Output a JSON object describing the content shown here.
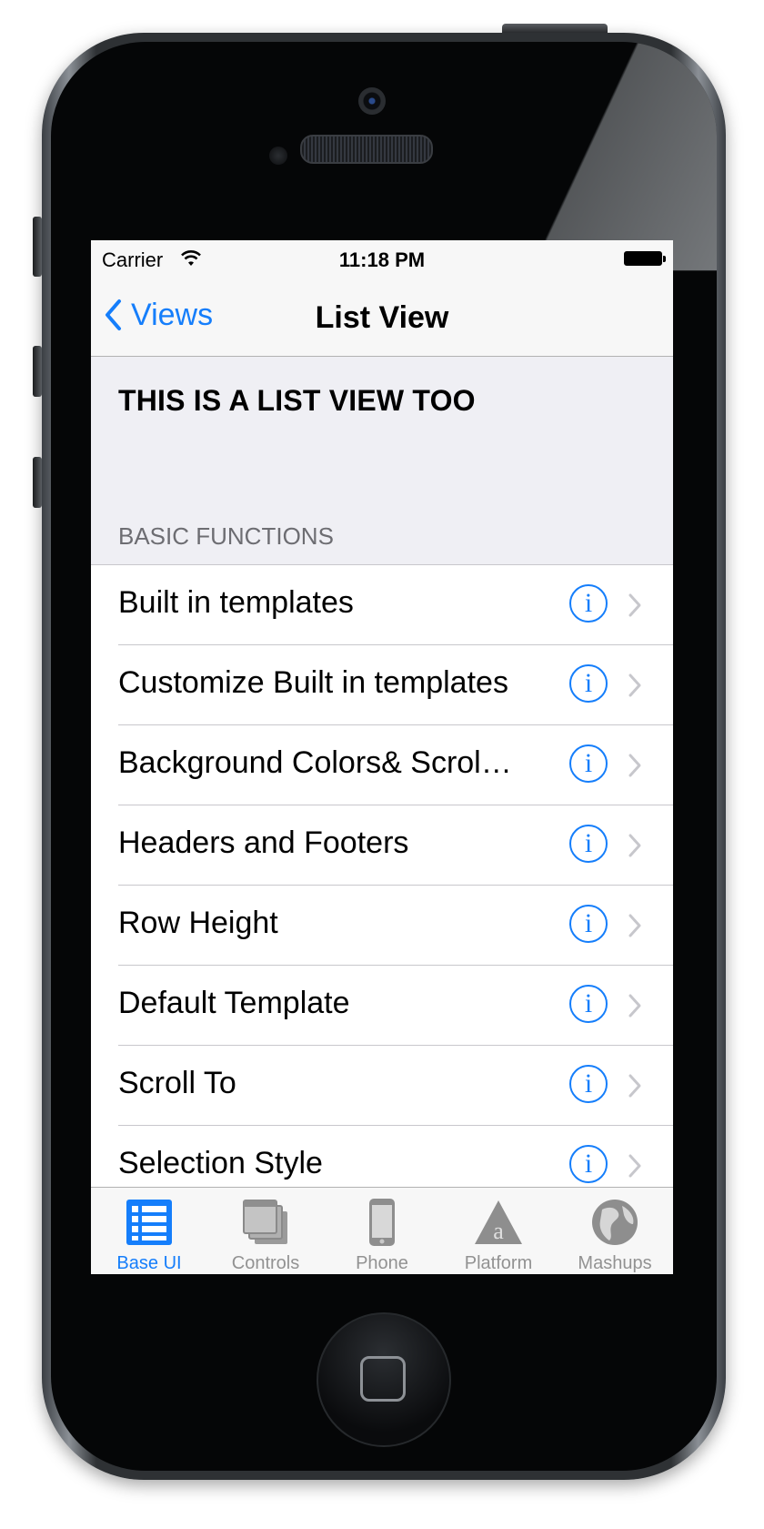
{
  "status_bar": {
    "carrier": "Carrier",
    "time": "11:18 PM"
  },
  "nav": {
    "back_label": "Views",
    "title": "List View"
  },
  "list": {
    "header_title": "THIS IS A LIST VIEW TOO",
    "section_header": "BASIC FUNCTIONS",
    "rows": [
      {
        "label": "Built in templates",
        "info": "i"
      },
      {
        "label": "Customize Built in templates",
        "info": "i"
      },
      {
        "label": "Background Colors& Scroll…",
        "info": "i"
      },
      {
        "label": "Headers and Footers",
        "info": "i"
      },
      {
        "label": "Row Height",
        "info": "i"
      },
      {
        "label": "Default Template",
        "info": "i"
      },
      {
        "label": "Scroll To",
        "info": "i"
      },
      {
        "label": "Selection Style",
        "info": "i"
      }
    ]
  },
  "tabs": [
    {
      "label": "Base UI",
      "icon": "list-grid-icon",
      "active": true
    },
    {
      "label": "Controls",
      "icon": "stacked-windows-icon",
      "active": false
    },
    {
      "label": "Phone",
      "icon": "phone-icon",
      "active": false
    },
    {
      "label": "Platform",
      "icon": "platform-a-icon",
      "active": false
    },
    {
      "label": "Mashups",
      "icon": "globe-icon",
      "active": false
    }
  ],
  "colors": {
    "accent": "#157efb",
    "inactive_tab": "#929292",
    "group_background": "#efeff4"
  }
}
